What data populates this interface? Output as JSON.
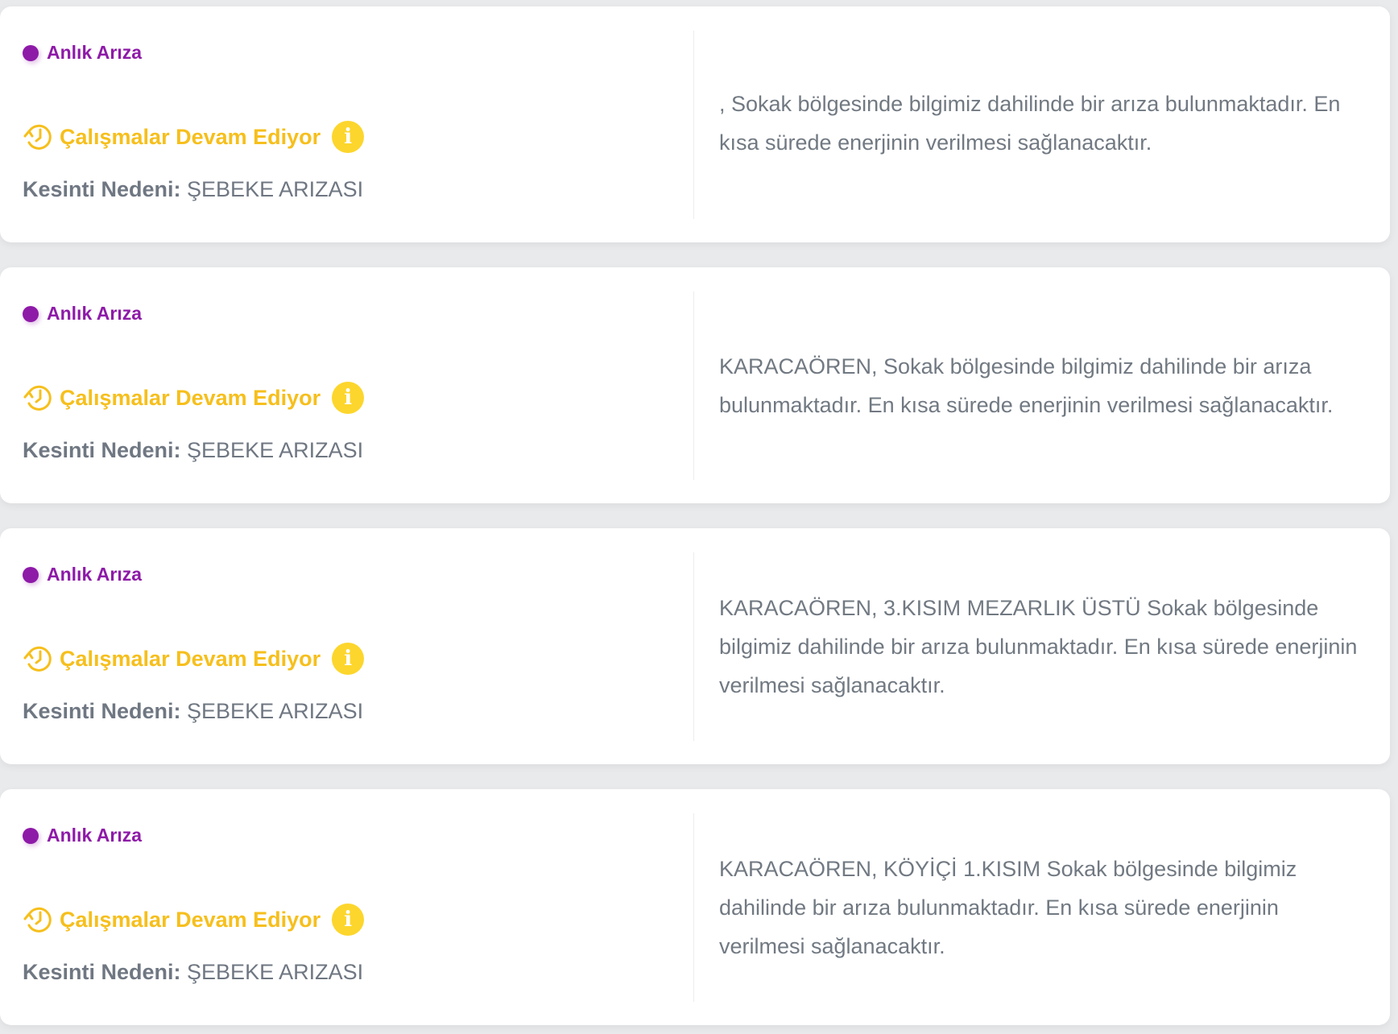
{
  "colors": {
    "type_accent": "#8e1aa8",
    "status_accent": "#f6bf1c",
    "info_badge": "#fcd62c",
    "text_muted": "#6f7782"
  },
  "icons": {
    "status": "clock-rotate-icon",
    "info": "info-icon",
    "type": "dot-icon"
  },
  "outages": [
    {
      "type": "Anlık Arıza",
      "status": "Çalışmalar Devam Ediyor",
      "info_symbol": "i",
      "reason_label": "Kesinti Nedeni:",
      "reason": " ŞEBEKE ARIZASI",
      "message": ", Sokak bölgesinde bilgimiz dahilinde bir arıza bulunmaktadır. En kısa sürede enerjinin verilmesi sağlanacaktır."
    },
    {
      "type": "Anlık Arıza",
      "status": "Çalışmalar Devam Ediyor",
      "info_symbol": "i",
      "reason_label": "Kesinti Nedeni:",
      "reason": " ŞEBEKE ARIZASI",
      "message": "KARACAÖREN, Sokak bölgesinde bilgimiz dahilinde bir arıza bulunmaktadır. En kısa sürede enerjinin verilmesi sağlanacaktır."
    },
    {
      "type": "Anlık Arıza",
      "status": "Çalışmalar Devam Ediyor",
      "info_symbol": "i",
      "reason_label": "Kesinti Nedeni:",
      "reason": " ŞEBEKE ARIZASI",
      "message": "KARACAÖREN, 3.KISIM MEZARLIK ÜSTÜ Sokak bölgesinde bilgimiz dahilinde bir arıza bulunmaktadır. En kısa sürede enerjinin verilmesi sağlanacaktır."
    },
    {
      "type": "Anlık Arıza",
      "status": "Çalışmalar Devam Ediyor",
      "info_symbol": "i",
      "reason_label": "Kesinti Nedeni:",
      "reason": " ŞEBEKE ARIZASI",
      "message": "KARACAÖREN, KÖYİÇİ 1.KISIM Sokak bölgesinde bilgimiz dahilinde bir arıza bulunmaktadır. En kısa sürede enerjinin verilmesi sağlanacaktır."
    }
  ]
}
